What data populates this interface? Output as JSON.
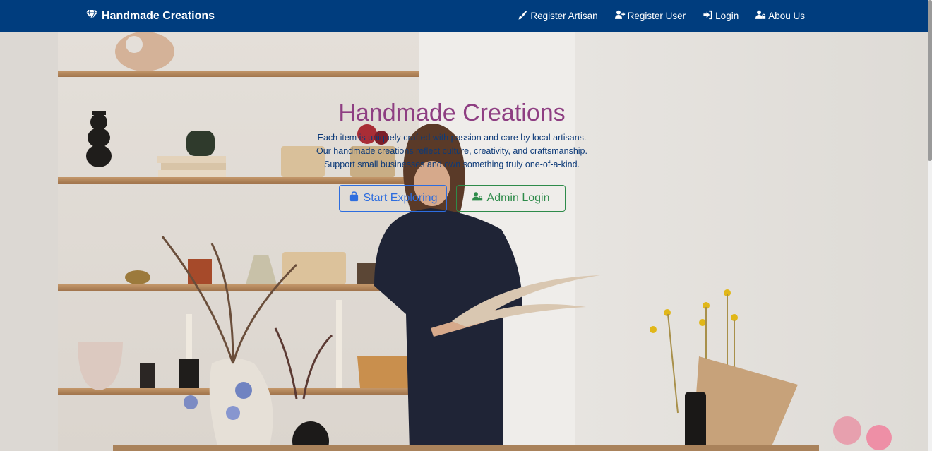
{
  "navbar": {
    "brand": {
      "icon": "gem-icon",
      "label": "Handmade Creations"
    },
    "links": [
      {
        "icon": "paintbrush-icon",
        "label": "Register Artisan"
      },
      {
        "icon": "user-plus-icon",
        "label": "Register User"
      },
      {
        "icon": "sign-in-icon",
        "label": "Login"
      },
      {
        "icon": "user-lock-icon",
        "label": "Abou Us"
      }
    ],
    "background_color": "#003d7e"
  },
  "hero": {
    "title": "Handmade Creations",
    "lines": [
      "Each item is uniquely crafted with passion and care by local artisans.",
      "Our handmade creations reflect culture, creativity, and craftsmanship.",
      "Support small businesses and own something truly one-of-a-kind."
    ],
    "title_color": "#8e3e82",
    "text_color": "#0d3a78",
    "buttons": {
      "explore": {
        "icon": "shopping-bag-icon",
        "label": "Start Exploring",
        "color": "#2d6ddf"
      },
      "admin": {
        "icon": "user-lock-icon",
        "label": "Admin Login",
        "color": "#2e8b4a"
      }
    }
  },
  "background_image": "woman-arranging-dried-flowers-in-shop"
}
